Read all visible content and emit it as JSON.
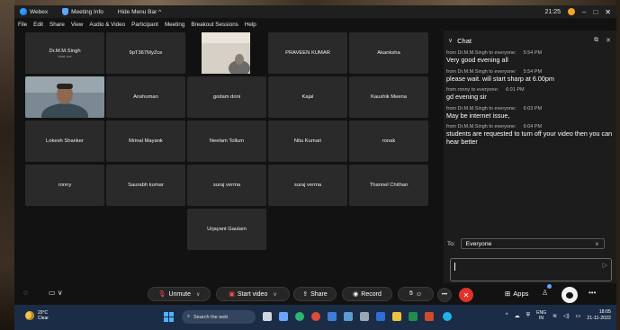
{
  "titlebar": {
    "app_name": "Webex",
    "meeting_info": "Meeting Info",
    "hide_menu": "Hide Menu Bar ^",
    "time": "21:25",
    "minimize": "–",
    "maximize": "□",
    "close": "✕"
  },
  "menu": [
    "File",
    "Edit",
    "Share",
    "View",
    "Audio & Video",
    "Participant",
    "Meeting",
    "Breakout Sessions",
    "Help"
  ],
  "participants": {
    "row1": [
      {
        "name": "Dr.M.M.Singh",
        "sub": "Host, me"
      },
      {
        "name": "9pT367MyZce"
      },
      {
        "name": ""
      },
      {
        "name": "PRAVEEN KUMAR"
      },
      {
        "name": "Akanksha"
      }
    ],
    "row2": [
      {
        "name": ""
      },
      {
        "name": "Anshuman"
      },
      {
        "name": "godam doni"
      },
      {
        "name": "Kajal"
      },
      {
        "name": "Kaushik Meena"
      }
    ],
    "row3": [
      {
        "name": "Lokesh Shanker"
      },
      {
        "name": "Mrinal Mayank"
      },
      {
        "name": "Neelam Tollum"
      },
      {
        "name": "Nitu Kumari"
      },
      {
        "name": "ronak"
      }
    ],
    "row4": [
      {
        "name": "ronny"
      },
      {
        "name": "Saurabh kumar"
      },
      {
        "name": "suraj verma"
      },
      {
        "name": "suraj verma"
      },
      {
        "name": "Thannel Chithan"
      }
    ],
    "row5": [
      {
        "name": "Urjayant Gautam"
      }
    ]
  },
  "chat": {
    "title": "Chat",
    "messages": [
      {
        "from": "from Dr.M.M.Singh to everyone:",
        "time": "5:54 PM",
        "text": "Very good evening all"
      },
      {
        "from": "from Dr.M.M.Singh to everyone:",
        "time": "5:54 PM",
        "text": "please wait. will start sharp at 6.00pm"
      },
      {
        "from": "from ronny to everyone:",
        "time": "6:01 PM",
        "text": "gd evening sir"
      },
      {
        "from": "from Dr.M.M.Singh to everyone:",
        "time": "6:03 PM",
        "text": "May be internet issue,"
      },
      {
        "from": "from Dr.M.M.Singh to everyone:",
        "time": "6:04 PM",
        "text": "students are requested to turn off your video then you can hear better"
      }
    ],
    "to_label": "To:",
    "to_value": "Everyone"
  },
  "controls": {
    "unmute": "Unmute",
    "start_video": "Start video",
    "share": "Share",
    "record": "Record",
    "apps": "Apps"
  },
  "taskbar": {
    "temp": "20°C",
    "weather": "Clear",
    "search": "Search the web",
    "lang1": "ENG",
    "lang2": "IN",
    "time": "18:05",
    "date": "21-11-2022"
  },
  "colors": {
    "leave": "#e0312b",
    "mute_icon": "#ff4a4a",
    "taskbar": "#1b2c46"
  }
}
